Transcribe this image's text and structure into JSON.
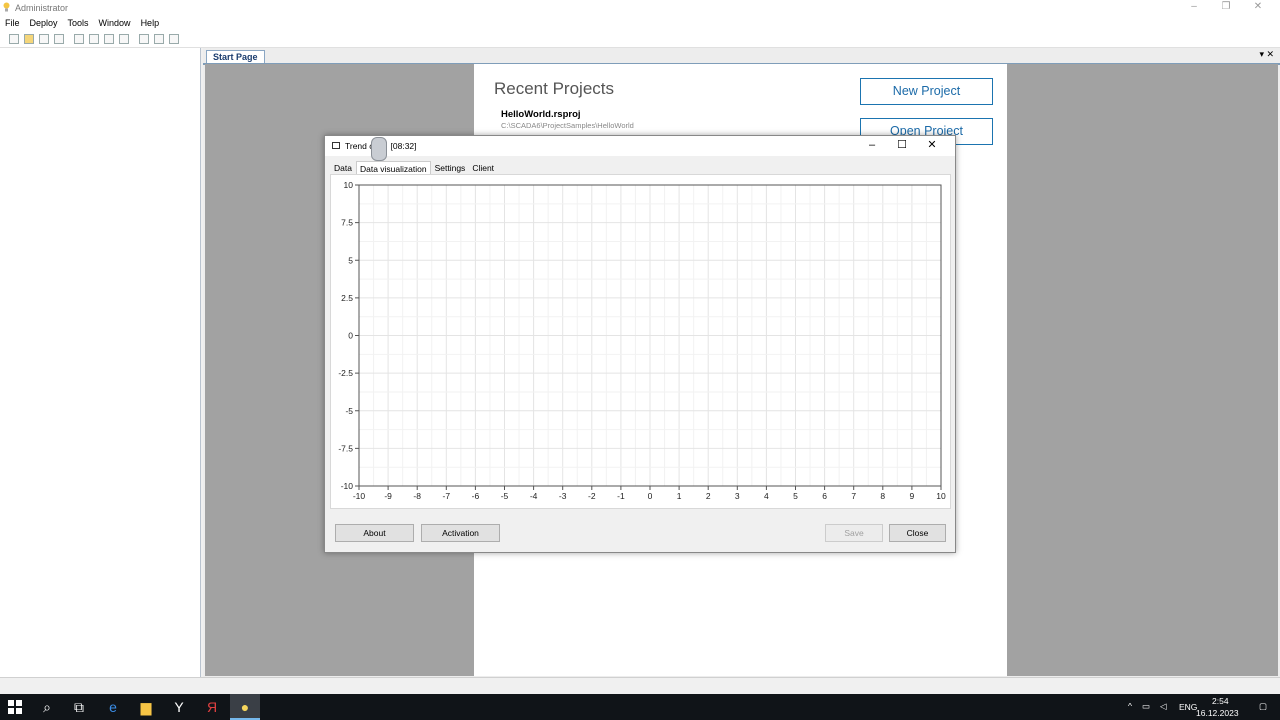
{
  "app": {
    "title": "Administrator",
    "window_controls": [
      "–",
      "❐",
      "✕"
    ]
  },
  "menu": [
    "File",
    "Deploy",
    "Tools",
    "Window",
    "Help"
  ],
  "document_tab": {
    "label": "Start Page",
    "controls": "▾ ✕"
  },
  "start_page": {
    "recent_title": "Recent Projects",
    "project_name": "HelloWorld.rsproj",
    "project_path": "C:\\SCADA6\\ProjectSamples\\HelloWorld",
    "new_project": "New Project",
    "open_project": "Open Project"
  },
  "dialog": {
    "title_prefix": "Trend c",
    "title_suffix": "[08:32]",
    "controls": [
      "–",
      "☐",
      "✕"
    ],
    "tabs": [
      "Data",
      "Data visualization",
      "Settings",
      "Client"
    ],
    "active_tab": "Data visualization",
    "buttons": {
      "about": "About",
      "activation": "Activation",
      "save": "Save",
      "close": "Close"
    }
  },
  "chart_data": {
    "type": "line",
    "series": [],
    "xlim": [
      -10,
      10
    ],
    "ylim": [
      -10,
      10
    ],
    "x_ticks": [
      "-10",
      "-9",
      "-8",
      "-7",
      "-6",
      "-5",
      "-4",
      "-3",
      "-2",
      "-1",
      "0",
      "1",
      "2",
      "3",
      "4",
      "5",
      "6",
      "7",
      "8",
      "9",
      "10"
    ],
    "y_ticks": [
      "10",
      "7.5",
      "5",
      "2.5",
      "0",
      "-2.5",
      "-5",
      "-7.5",
      "-10"
    ],
    "grid": true
  },
  "taskbar": {
    "language": "ENG",
    "time": "2:54",
    "date": "16.12.2023",
    "accent": "#76b9ed"
  }
}
